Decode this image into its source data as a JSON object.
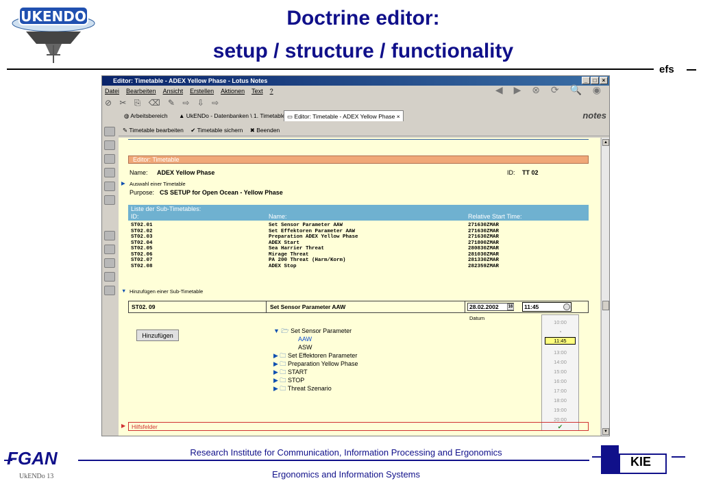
{
  "slide": {
    "title_line1": "Doctrine editor:",
    "title_line2": "setup / structure / functionality",
    "corner_label": "efs",
    "logo_text": "UKENDO"
  },
  "window": {
    "title": "Editor: Timetable  - ADEX Yellow Phase - Lotus Notes",
    "menu": [
      "Datei",
      "Bearbeiten",
      "Ansicht",
      "Erstellen",
      "Aktionen",
      "Text",
      "?"
    ],
    "tabs": [
      "Arbeitsbereich",
      "UkENDo - Datenbanken \\ 1. Timetables",
      "Editor: Timetable - ADEX Yellow Phase"
    ],
    "tab_close": "×",
    "notes_logo": "notes",
    "actions": [
      "Timetable bearbeiten",
      "Timetable sichern",
      "Beenden"
    ]
  },
  "form": {
    "header": "Editor: Timetable",
    "name_label": "Name:",
    "name_value": "ADEX Yellow Phase",
    "id_label": "ID:",
    "id_value": "TT  02",
    "select_label": "Auswahl einer Timetable",
    "purpose_label": "Purpose:",
    "purpose_value": "CS SETUP for Open Ocean - Yellow Phase",
    "list_title": "Liste der Sub-Timetables:",
    "col_id": "ID:",
    "col_name": "Name:",
    "col_time": "Relative Start Time:",
    "rows": [
      {
        "id": "ST02.01",
        "name": "Set Sensor Parameter AAW",
        "time": "271630ZMAR"
      },
      {
        "id": "ST02.02",
        "name": "Set Effektoren Parameter AAW",
        "time": "271630ZMAR"
      },
      {
        "id": "ST02.03",
        "name": "Preparation ADEX Yellow Phase",
        "time": "271630ZMAR"
      },
      {
        "id": "ST02.04",
        "name": "ADEX Start",
        "time": "271800ZMAR"
      },
      {
        "id": "ST02.05",
        "name": "Sea Harrier Threat",
        "time": "280830ZMAR"
      },
      {
        "id": "ST02.06",
        "name": "Mirage Threat",
        "time": "281030ZMAR"
      },
      {
        "id": "ST02.07",
        "name": "PA 200 Threat (Harm/Korm)",
        "time": "281330ZMAR"
      },
      {
        "id": "ST02.08",
        "name": "ADEX Stop",
        "time": "282359ZMAR"
      }
    ],
    "add_section_label": "Hinzufügen einer Sub-Timetable",
    "new_id": "ST02.  09",
    "new_name": "Set Sensor Parameter AAW",
    "new_date": "28.02.2002",
    "new_time": "11:45",
    "date_label": "Datum",
    "cal_icon": "16",
    "add_button": "Hinzufügen",
    "tree": [
      {
        "label": "Set Sensor Parameter",
        "open": true
      },
      {
        "label": "AAW",
        "leaf": true,
        "selected": true
      },
      {
        "label": "ASW",
        "leaf": true
      },
      {
        "label": "Set Effektoren Parameter"
      },
      {
        "label": "Preparation Yellow Phase"
      },
      {
        "label": "START"
      },
      {
        "label": "STOP"
      },
      {
        "label": "Threat Szenario"
      }
    ],
    "time_options": [
      "10:00",
      "11:45",
      "13:00",
      "14:00",
      "15:00",
      "16:00",
      "17:00",
      "18:00",
      "19:00",
      "20:00"
    ],
    "hilfsfelder": "Hilfsfelder"
  },
  "footer": {
    "org": "FGAN",
    "line1": "Research Institute for Communication, Information Processing and Ergonomics",
    "line2": "Ergonomics and Information Systems",
    "page": "UkENDo   13",
    "kie": "KIE"
  },
  "colors": {
    "title_blue": "#10108a",
    "orange_band": "#f0a878",
    "blue_band": "#6fb1d0",
    "doc_bg": "#ffffd8"
  }
}
